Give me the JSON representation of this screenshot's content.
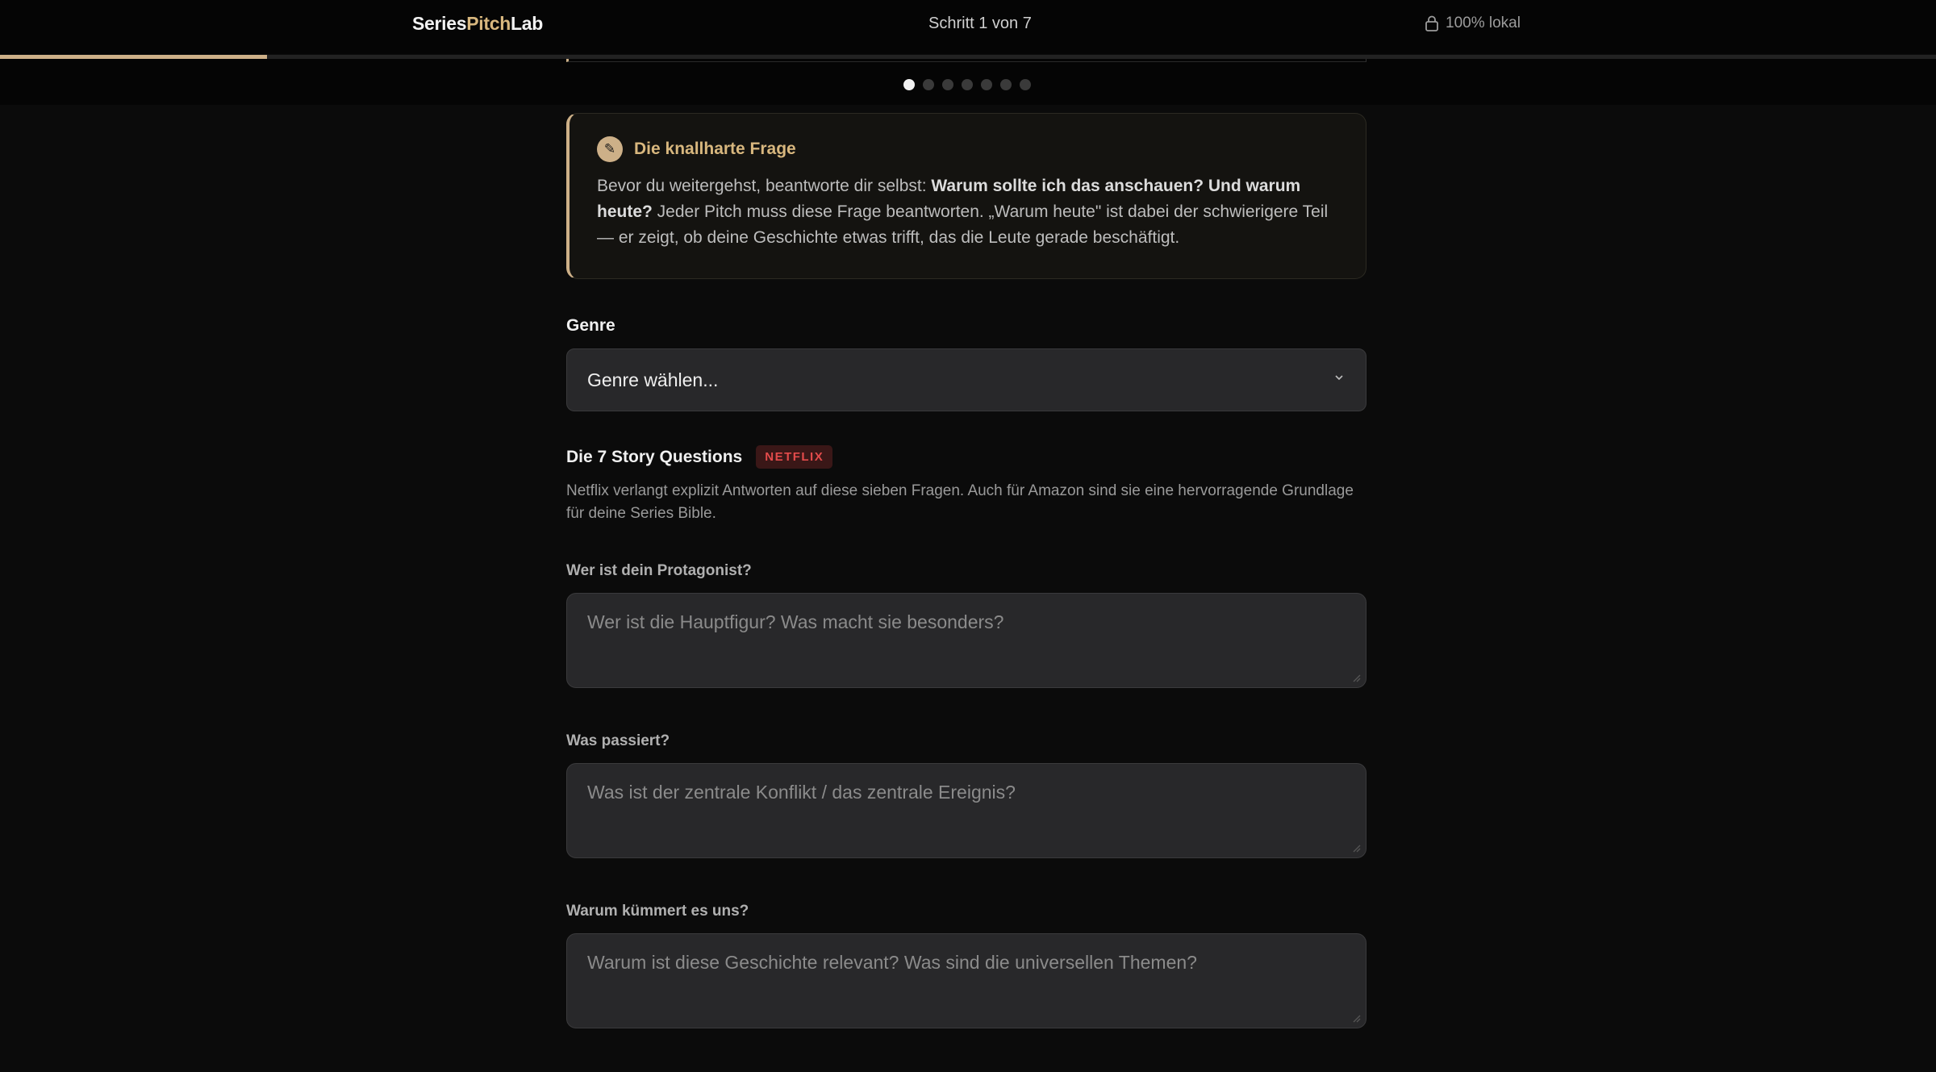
{
  "header": {
    "brand_part1": "Series",
    "brand_part2": "Pitch",
    "brand_part3": "Lab",
    "step_text": "Schritt 1 von 7",
    "local_text": "100% lokal"
  },
  "progress": {
    "fraction": 0.138,
    "steps_total": 7,
    "current_step": 1
  },
  "colors": {
    "accent": "#cdb088",
    "badge_red": "#e34b4b",
    "background": "#0b0b0b"
  },
  "callout": {
    "icon": "pencil-icon",
    "title": "Die knallharte Frage",
    "text_before": "Bevor du weitergehst, beantworte dir selbst: ",
    "text_bold": "Warum sollte ich das anschauen? Und warum heute?",
    "text_after": " Jeder Pitch muss diese Frage beantworten. „Warum heute\" ist dabei der schwierigere Teil — er zeigt, ob deine Geschichte etwas trifft, das die Leute gerade beschäftigt."
  },
  "genre": {
    "label": "Genre",
    "selected": "Genre wählen...",
    "icon": "chevron-down-icon"
  },
  "story_questions": {
    "title": "Die 7 Story Questions",
    "badge": "NETFLIX",
    "description": "Netflix verlangt explizit Antworten auf diese sieben Fragen. Auch für Amazon sind sie eine hervorragende Grundlage für deine Series Bible.",
    "questions": [
      {
        "label": "Wer ist dein Protagonist?",
        "placeholder": "Wer ist die Hauptfigur? Was macht sie besonders?"
      },
      {
        "label": "Was passiert?",
        "placeholder": "Was ist der zentrale Konflikt / das zentrale Ereignis?"
      },
      {
        "label": "Warum kümmert es uns?",
        "placeholder": "Warum ist diese Geschichte relevant? Was sind die universellen Themen?"
      }
    ]
  }
}
